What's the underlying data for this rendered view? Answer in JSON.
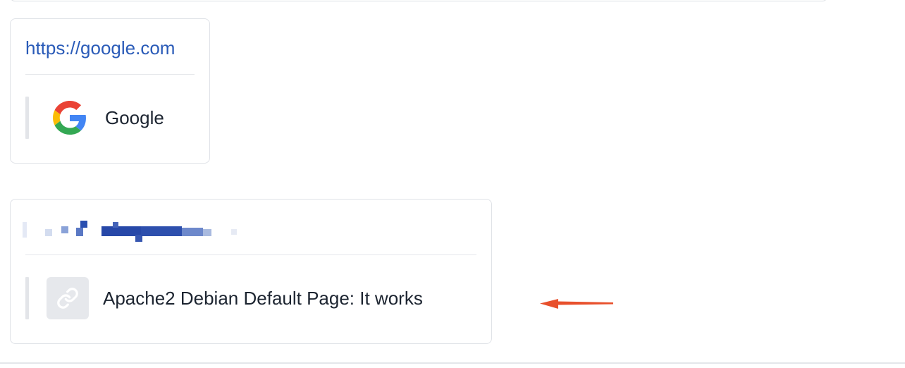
{
  "cards": [
    {
      "url": "https://google.com",
      "preview_title": "Google",
      "preview_icon": "google-g-logo"
    },
    {
      "url": "",
      "url_redacted": true,
      "preview_title": "Apache2 Debian Default Page: It works",
      "preview_icon": "link-icon"
    }
  ],
  "colors": {
    "link": "#2a5bb8",
    "arrow": "#e8502c",
    "preview_bar": "#e3e5e9",
    "icon_placeholder_bg": "#e6e8ec"
  }
}
